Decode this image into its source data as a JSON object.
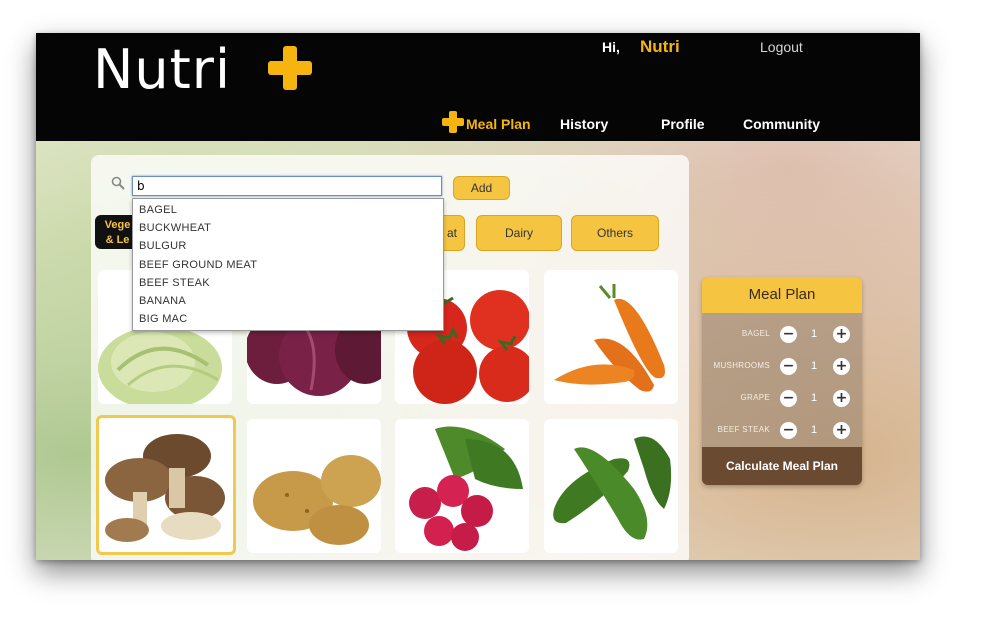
{
  "app": {
    "logo_text": "Nutri",
    "greeting": "Hi,",
    "username": "Nutri",
    "logout_label": "Logout"
  },
  "nav": {
    "items": [
      {
        "label": "Meal Plan",
        "active": true
      },
      {
        "label": "History"
      },
      {
        "label": "Profile"
      },
      {
        "label": "Community"
      }
    ]
  },
  "search": {
    "value": "b",
    "add_label": "Add",
    "suggestions": [
      "BAGEL",
      "BUCKWHEAT",
      "BULGUR",
      "BEEF GROUND MEAT",
      "BEEF STEAK",
      "BANANA",
      "BIG MAC"
    ]
  },
  "categories": {
    "first_line1": "Vege",
    "first_line2": "& Le",
    "partial": "at",
    "dairy": "Dairy",
    "others": "Others"
  },
  "tiles": [
    {
      "icon": "cabbage-image"
    },
    {
      "icon": "red-onion-image"
    },
    {
      "icon": "tomatoes-image"
    },
    {
      "icon": "carrots-image"
    },
    {
      "icon": "mushrooms-image",
      "selected": true
    },
    {
      "icon": "potatoes-image"
    },
    {
      "icon": "radishes-image"
    },
    {
      "icon": "cucumbers-image"
    }
  ],
  "meal_plan": {
    "title": "Meal Plan",
    "items": [
      {
        "name": "BAGEL",
        "qty": "1"
      },
      {
        "name": "MUSHROOMS",
        "qty": "1"
      },
      {
        "name": "GRAPE",
        "qty": "1"
      },
      {
        "name": "BEEF STEAK",
        "qty": "1"
      }
    ],
    "minus": "−",
    "plus": "+",
    "calculate_label": "Calculate Meal Plan"
  },
  "colors": {
    "accent": "#f5b40e",
    "button": "#f5c542",
    "topbar": "#050505",
    "calc": "#6b4a32"
  }
}
